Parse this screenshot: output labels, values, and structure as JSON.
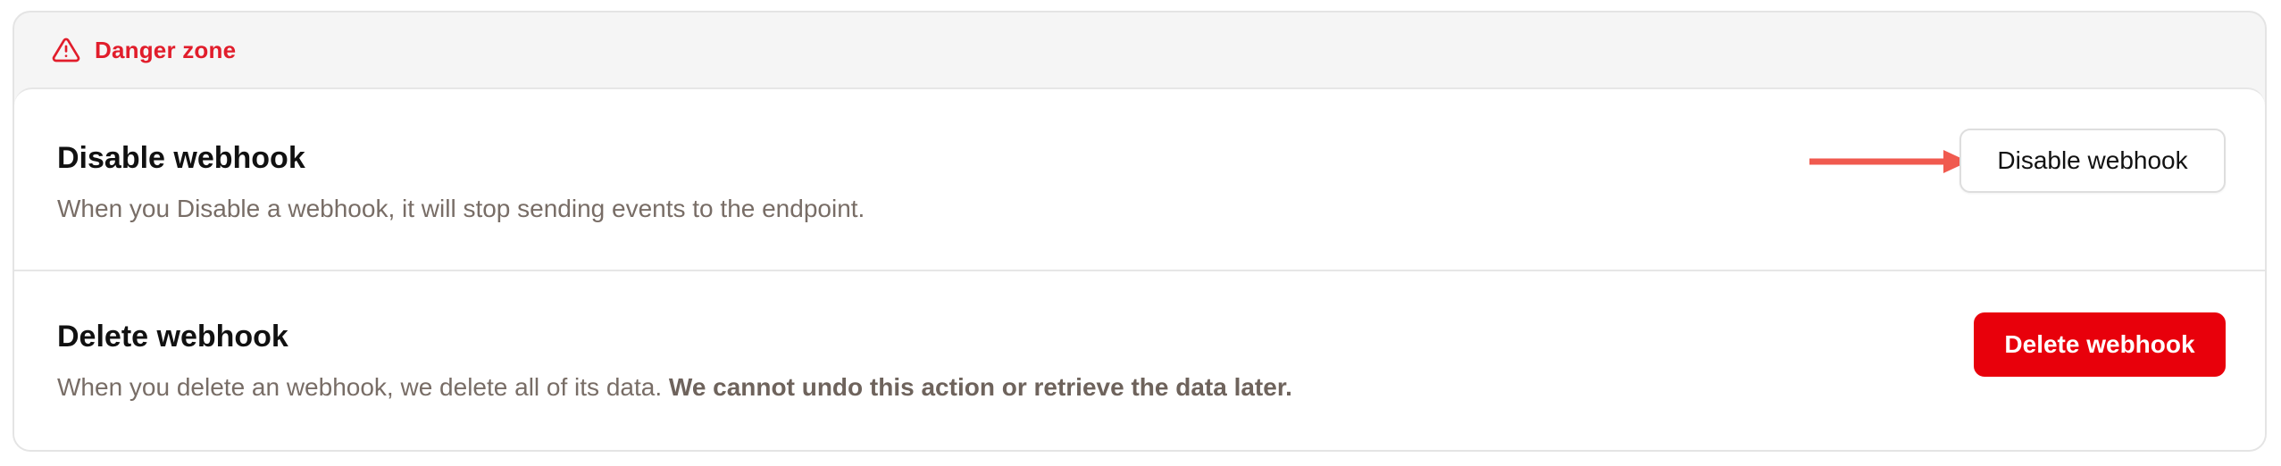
{
  "danger_zone": {
    "title": "Danger zone",
    "icon": "warning-triangle-icon",
    "accent_color": "#e11d2b"
  },
  "disable_section": {
    "title": "Disable webhook",
    "description": "When you Disable a webhook, it will stop sending events to the endpoint.",
    "button_label": "Disable webhook"
  },
  "delete_section": {
    "title": "Delete webhook",
    "description": "When you delete an webhook, we delete all of its data.",
    "description_emphasis": "We cannot undo this action or retrieve the data later.",
    "button_label": "Delete webhook",
    "button_color": "#e8000b"
  },
  "annotation": {
    "arrow_color": "#f05a4f",
    "arrow_icon": "arrow-right-icon"
  }
}
